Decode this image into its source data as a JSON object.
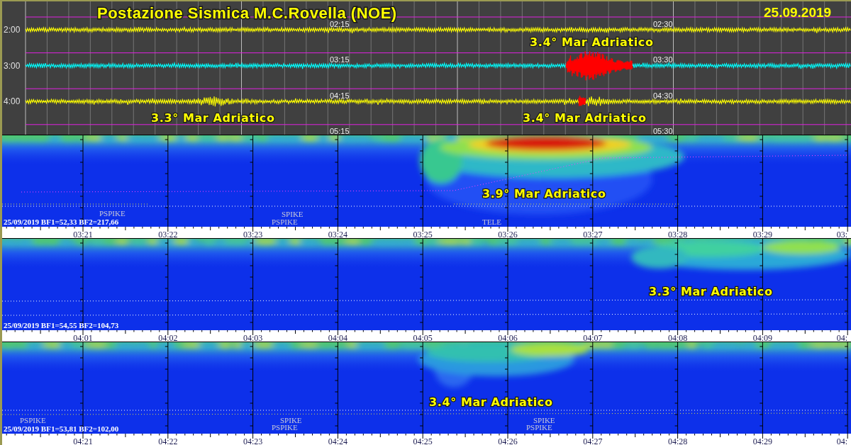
{
  "helicorder": {
    "title": "Postazione Sismica M.C.Rovella (NOE)",
    "date": "25.09.2019",
    "rows": [
      {
        "hour": "2:00",
        "color": "#ffff00",
        "highlighted": false,
        "marks": [
          "02:15",
          "02:30"
        ],
        "labels": [
          "3.4° Mar Adriatico"
        ]
      },
      {
        "hour": "3:00",
        "color": "#00ffff",
        "highlighted": true,
        "marks": [
          "03:15",
          "03:30"
        ]
      },
      {
        "hour": "4:00",
        "color": "#ffff00",
        "highlighted": true,
        "marks": [
          "04:15",
          "04:30"
        ],
        "labels": [
          "3.3° Mar Adriatico",
          "3.4° Mar Adriatico"
        ]
      }
    ],
    "bottom_marks": [
      "05:15",
      "05:30"
    ]
  },
  "spectrograms": [
    {
      "info": "25/09/2019 BF1=52,33 BF2=217,66",
      "event": "3.9° Mar Adriatico",
      "tags": [
        "PSPIKE",
        "SPIKE",
        "PSPIKE",
        "TELE"
      ],
      "times": [
        "03:21",
        "03:22",
        "03:23",
        "03:24",
        "03:25",
        "03:26",
        "03:27",
        "03:28",
        "03:29",
        "03:"
      ]
    },
    {
      "info": "25/09/2019 BF1=54,55 BF2=104,73",
      "event": "3.3° Mar Adriatico",
      "times": [
        "04:01",
        "04:02",
        "04:03",
        "04:04",
        "04:05",
        "04:06",
        "04:07",
        "04:08",
        "04:09",
        "04:"
      ]
    },
    {
      "info": "25/09/2019 BF1=53,81 BF2=102,00",
      "event": "3.4° Mar Adriatico",
      "tags": [
        "PSPIKE",
        "SPIKE",
        "PSPIKE",
        "SPIKE",
        "PSPIKE"
      ],
      "times": [
        "04:21",
        "04:22",
        "04:23",
        "04:24",
        "04:25",
        "04:26",
        "04:27",
        "04:28",
        "04:29",
        "04:"
      ]
    }
  ]
}
